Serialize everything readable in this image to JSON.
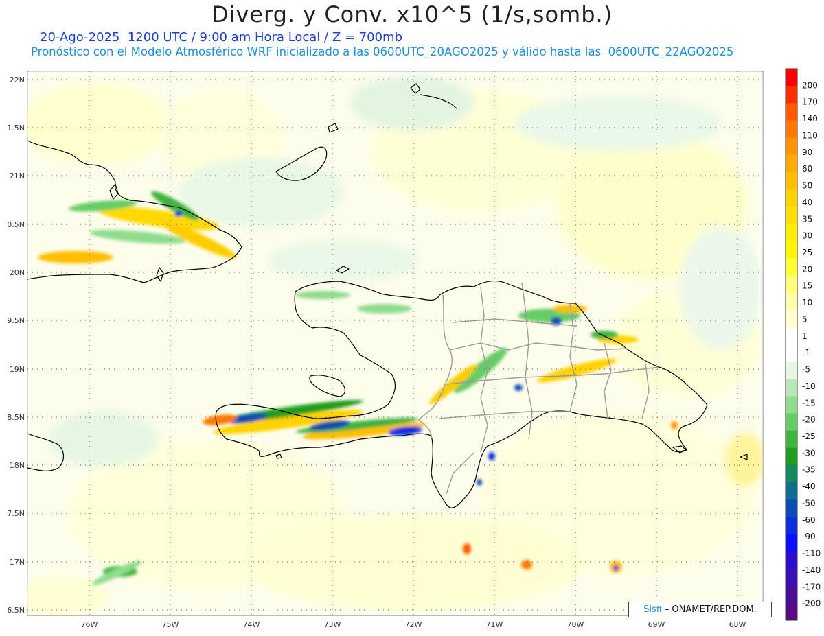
{
  "title": "Diverg. y Conv. x10^5 (1/s,somb.)",
  "subtitle_time": "20-Ago-2025  1200 UTC / 9:00 am Hora Local / Z = 700mb",
  "subtitle_model": "Pronóstico con el Modelo Atmosférico WRF inicializado a las 0600UTC_20AGO2025 y válido hasta las  0600UTC_22AGO2025",
  "map": {
    "lon_range": [
      -76.6,
      -67.6
    ],
    "lat_range": [
      6.3,
      22.1
    ],
    "lon_ticks": [
      "76W",
      "75W",
      "74W",
      "73W",
      "72W",
      "71W",
      "70W",
      "69W",
      "68W"
    ],
    "lat_ticks": [
      "22N",
      "1.5N",
      "21N",
      "0.5N",
      "20N",
      "9.5N",
      "19N",
      "8.5N",
      "18N",
      "7.5N",
      "17N",
      "6.5N"
    ],
    "grid": "dotted"
  },
  "colorbar": {
    "levels": [
      "200",
      "170",
      "140",
      "110",
      "90",
      "60",
      "50",
      "40",
      "35",
      "30",
      "25",
      "20",
      "15",
      "10",
      "5",
      "1",
      "-1",
      "-5",
      "-10",
      "-15",
      "-20",
      "-25",
      "-30",
      "-35",
      "-40",
      "-50",
      "-60",
      "-90",
      "-110",
      "-140",
      "-170",
      "-200"
    ],
    "colors": [
      "#ff0000",
      "#ff2d00",
      "#ff5a00",
      "#ff7800",
      "#ff9600",
      "#ffaa00",
      "#ffbe00",
      "#ffd200",
      "#ffe100",
      "#ffee00",
      "#fff500",
      "#ffff33",
      "#ffff7a",
      "#ffffa8",
      "#ffffd0",
      "#ffffff",
      "#ffffff",
      "#e6f7e6",
      "#b8e8b8",
      "#8fdc8f",
      "#66cc66",
      "#3fb43f",
      "#1e9e1e",
      "#138a5a",
      "#0e6e8c",
      "#0a4db4",
      "#0a2ee0",
      "#0f0fff",
      "#2a0fd0",
      "#3a10b0",
      "#4a0f95",
      "#5a0a85"
    ]
  },
  "credit": {
    "brand": "Sisπ",
    "text": " – ONAMET/REP.DOM."
  }
}
